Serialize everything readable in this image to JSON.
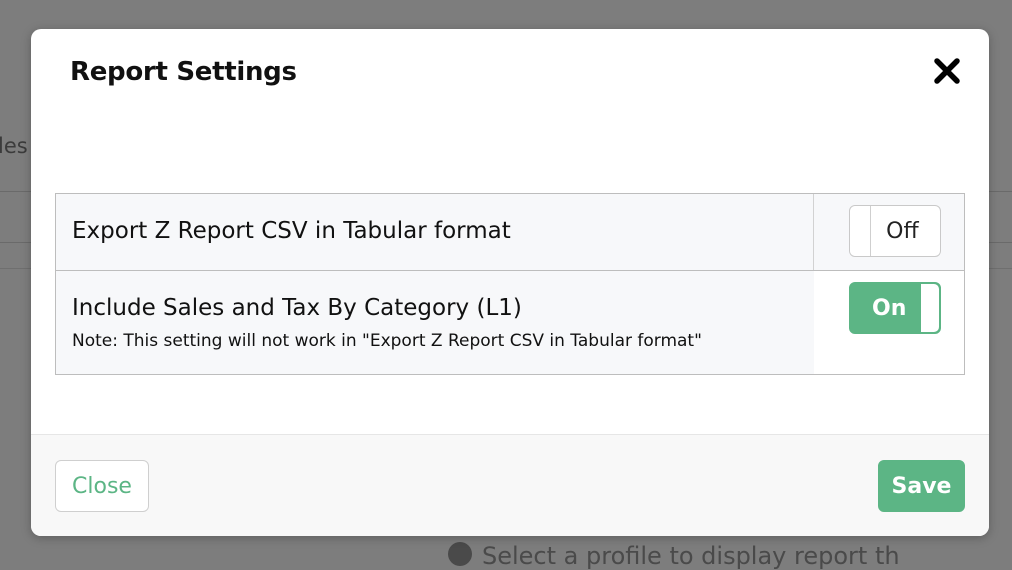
{
  "background": {
    "tab_fragment": "les",
    "bottom_fragment": "Select a profile to display report th"
  },
  "modal": {
    "title": "Report Settings",
    "close_icon": "close-x-icon"
  },
  "settings": [
    {
      "label": "Export Z Report CSV in Tabular format",
      "note": "",
      "toggle_state": "Off",
      "enabled": false
    },
    {
      "label": "Include Sales and Tax By Category (L1)",
      "note": "Note: This setting will not work in \"Export Z Report CSV in Tabular format\"",
      "toggle_state": "On",
      "enabled": true
    }
  ],
  "footer": {
    "close_label": "Close",
    "save_label": "Save"
  },
  "colors": {
    "accent": "#5cb585",
    "overlay": "#7d7d7d"
  }
}
